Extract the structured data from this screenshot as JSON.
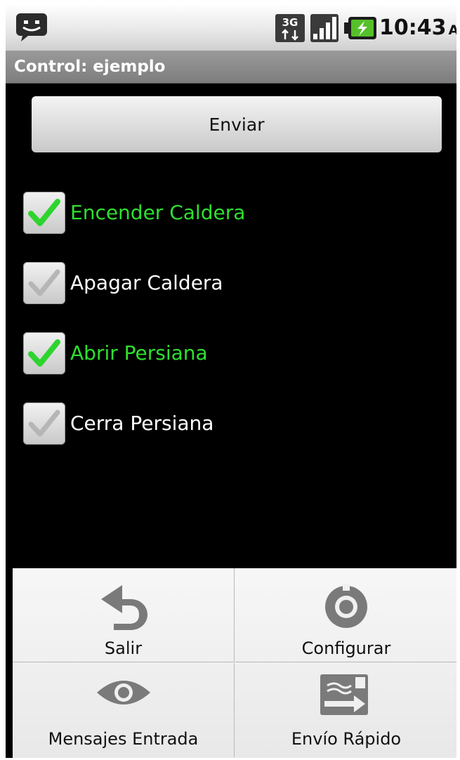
{
  "status_bar": {
    "icons": [
      "message-notification-icon",
      "3g-data-icon",
      "signal-strength-icon",
      "battery-charging-icon"
    ],
    "time": "10:43",
    "ampm": "AM"
  },
  "title_bar": {
    "title": "Control: ejemplo"
  },
  "send_button": {
    "label": "Enviar"
  },
  "checkboxes": [
    {
      "label": "Encender Caldera",
      "checked": true
    },
    {
      "label": "Apagar Caldera",
      "checked": false
    },
    {
      "label": "Abrir Persiana",
      "checked": true
    },
    {
      "label": "Cerra Persiana",
      "checked": false
    }
  ],
  "menu": {
    "items": [
      {
        "label": "Salir",
        "icon": "undo-arrow-icon"
      },
      {
        "label": "Configurar",
        "icon": "gear-icon"
      },
      {
        "label": "Mensajes Entrada",
        "icon": "eye-icon"
      },
      {
        "label": "Envío Rápido",
        "icon": "quick-send-icon"
      }
    ]
  },
  "colors": {
    "checked_text": "#2ee02e",
    "unchecked_text": "#ffffff",
    "background": "#000000"
  }
}
